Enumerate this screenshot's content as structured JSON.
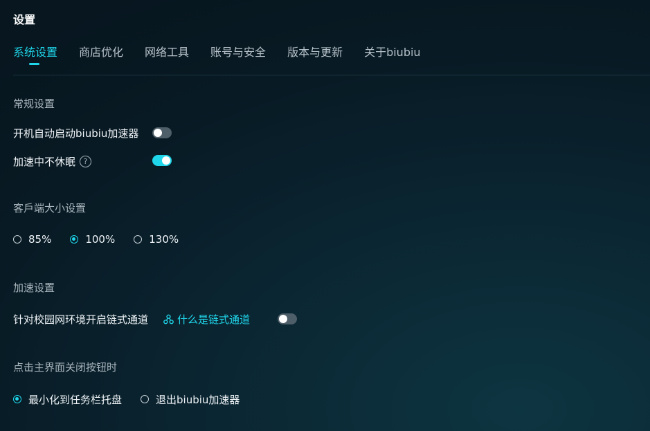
{
  "page": {
    "title": "设置"
  },
  "tabs": [
    {
      "label": "系统设置",
      "active": true
    },
    {
      "label": "商店优化",
      "active": false
    },
    {
      "label": "网络工具",
      "active": false
    },
    {
      "label": "账号与安全",
      "active": false
    },
    {
      "label": "版本与更新",
      "active": false
    },
    {
      "label": "关于biubiu",
      "active": false
    }
  ],
  "general": {
    "title": "常规设置",
    "autostart": {
      "label": "开机自动启动biubiu加速器",
      "enabled": false
    },
    "nosleep": {
      "label": "加速中不休眠",
      "help_icon": "question-circle-icon",
      "help_glyph": "?",
      "enabled": true
    }
  },
  "client_size": {
    "title": "客戶端大小设置",
    "options": [
      {
        "label": "85%",
        "checked": false
      },
      {
        "label": "100%",
        "checked": true
      },
      {
        "label": "130%",
        "checked": false
      }
    ]
  },
  "acceleration": {
    "title": "加速设置",
    "campus": {
      "label": "针对校园网环境开启链式通道",
      "enabled": false
    },
    "link": {
      "label": "什么是链式通道",
      "icon": "chain-nodes-icon"
    }
  },
  "close_action": {
    "title": "点击主界面关闭按钮时",
    "options": [
      {
        "label": "最小化到任务栏托盘",
        "checked": true
      },
      {
        "label": "退出biubiu加速器",
        "checked": false
      }
    ]
  },
  "colors": {
    "accent": "#1fd6ea",
    "toggle_off": "#4f5f69",
    "background": "#081a24"
  }
}
